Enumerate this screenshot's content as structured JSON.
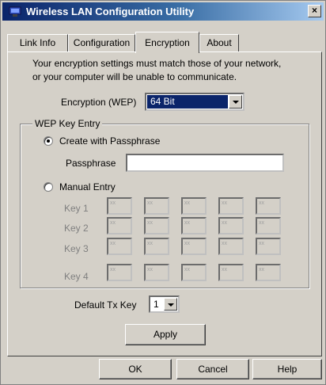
{
  "window": {
    "title": "Wireless LAN Configuration Utility",
    "close_glyph": "×"
  },
  "tabs": [
    "Link Info",
    "Configuration",
    "Encryption",
    "About"
  ],
  "active_tab": "Encryption",
  "info_line1": "Your encryption settings must match those of your network,",
  "info_line2": "or your computer will be unable to communicate.",
  "encryption": {
    "label": "Encryption (WEP)",
    "value": "64 Bit"
  },
  "wep": {
    "group_title": "WEP Key Entry",
    "passphrase_option": "Create with Passphrase",
    "passphrase_label": "Passphrase",
    "passphrase_value": "",
    "manual_option": "Manual Entry",
    "selected": "passphrase",
    "keys": [
      {
        "label": "Key 1",
        "fields": [
          "xx",
          "xx",
          "xx",
          "xx",
          "xx"
        ]
      },
      {
        "label": "Key 2",
        "fields": [
          "xx",
          "xx",
          "xx",
          "xx",
          "xx"
        ]
      },
      {
        "label": "Key 3",
        "fields": [
          "xx",
          "xx",
          "xx",
          "xx",
          "xx"
        ]
      },
      {
        "label": "Key 4",
        "fields": [
          "xx",
          "xx",
          "xx",
          "xx",
          "xx"
        ]
      }
    ]
  },
  "tx_key": {
    "label": "Default Tx Key",
    "value": "1"
  },
  "buttons": {
    "apply": "Apply",
    "ok": "OK",
    "cancel": "Cancel",
    "help": "Help"
  },
  "icons": {
    "app": "network-adapter-icon",
    "close": "close-icon",
    "dropdown": "chevron-down-icon"
  },
  "colors": {
    "titlebar_start": "#0a246a",
    "titlebar_end": "#a6caf0",
    "face": "#d4d0c8",
    "selection": "#0a246a"
  }
}
